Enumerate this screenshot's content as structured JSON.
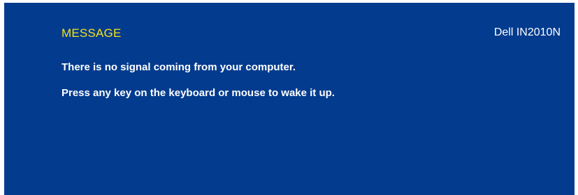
{
  "osd": {
    "title": "MESSAGE",
    "model": "Dell IN2010N",
    "lines": [
      "There is no signal coming from your computer.",
      "Press any key on the keyboard or mouse to wake it up."
    ]
  },
  "colors": {
    "background": "#033b8e",
    "title": "#f3e21a",
    "text": "#ffffff"
  }
}
